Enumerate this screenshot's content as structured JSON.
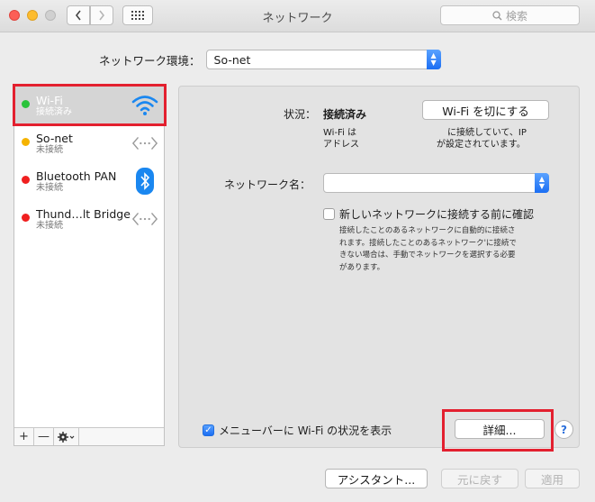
{
  "window": {
    "title": "ネットワーク",
    "search_placeholder": "検索"
  },
  "location": {
    "label": "ネットワーク環境：",
    "value": "So-net"
  },
  "services": [
    {
      "name": "Wi-Fi",
      "status": "接続済み",
      "status_color": "#2ac33b",
      "icon": "wifi-icon",
      "selected": true
    },
    {
      "name": "So-net",
      "status": "未接続",
      "status_color": "#f5b300",
      "icon": "ppp-icon",
      "selected": false
    },
    {
      "name": "Bluetooth PAN",
      "status": "未接続",
      "status_color": "#f01f1f",
      "icon": "bluetooth-icon",
      "selected": false
    },
    {
      "name": "Thund…lt Bridge",
      "status": "未接続",
      "status_color": "#f01f1f",
      "icon": "ethernet-icon",
      "selected": false
    }
  ],
  "sidebar_bottom": {
    "add": "+",
    "remove": "—",
    "action_menu": "gear-icon"
  },
  "detail": {
    "status_label": "状況：",
    "status_value": "接続済み",
    "toggle_button": "Wi-Fi を切にする",
    "desc_left_1": "Wi-Fi は",
    "desc_left_2": "アドレス",
    "desc_right_1": "に接続していて、IP",
    "desc_right_2": "が設定されています。",
    "network_name_label": "ネットワーク名：",
    "network_name_value": "",
    "ask_join_label": "新しいネットワークに接続する前に確認",
    "ask_join_checked": false,
    "ask_join_desc_1": "接続したことのあるネットワークに自動的に接続さ",
    "ask_join_desc_2": "れます。接続したことのあるネットワーク'に接続で",
    "ask_join_desc_3": "きない場合は、手動でネットワークを選択する必要",
    "ask_join_desc_4": "があります。",
    "show_menu_label": "メニューバーに Wi-Fi の状況を表示",
    "show_menu_checked": true,
    "advanced_button": "詳細...",
    "help": "?"
  },
  "footer": {
    "assistant_button": "アシスタント...",
    "revert_button": "元に戻す",
    "apply_button": "適用"
  },
  "colors": {
    "highlight_box": "#e3202f",
    "accent": "#1b6ef3"
  }
}
